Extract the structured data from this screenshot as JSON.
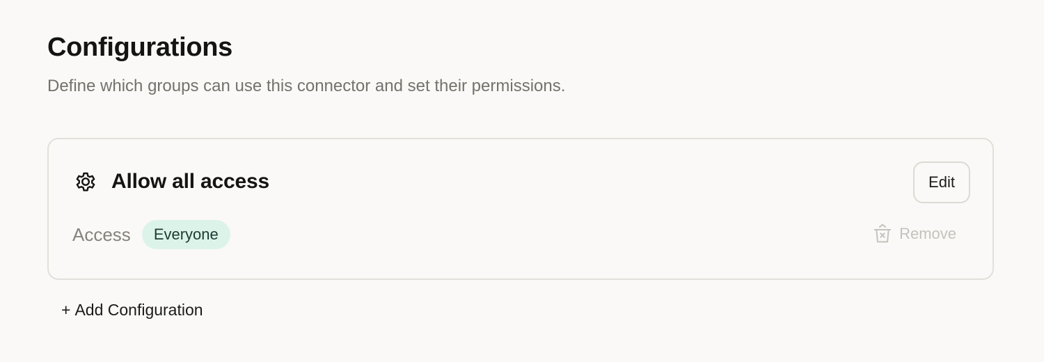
{
  "header": {
    "title": "Configurations",
    "subtitle": "Define which groups can use this connector and set their permissions."
  },
  "configuration": {
    "icon": "gear-icon",
    "title": "Allow all access",
    "edit_label": "Edit",
    "access_label": "Access",
    "access_value": "Everyone",
    "remove_icon": "trash-icon",
    "remove_label": "Remove"
  },
  "actions": {
    "add_plus": "+",
    "add_label": "Add Configuration"
  },
  "colors": {
    "background": "#faf9f7",
    "badge_bg": "#dcf3ea",
    "badge_text": "#1d3b32",
    "muted_text": "#73726c",
    "disabled_text": "#c4c2bc"
  }
}
